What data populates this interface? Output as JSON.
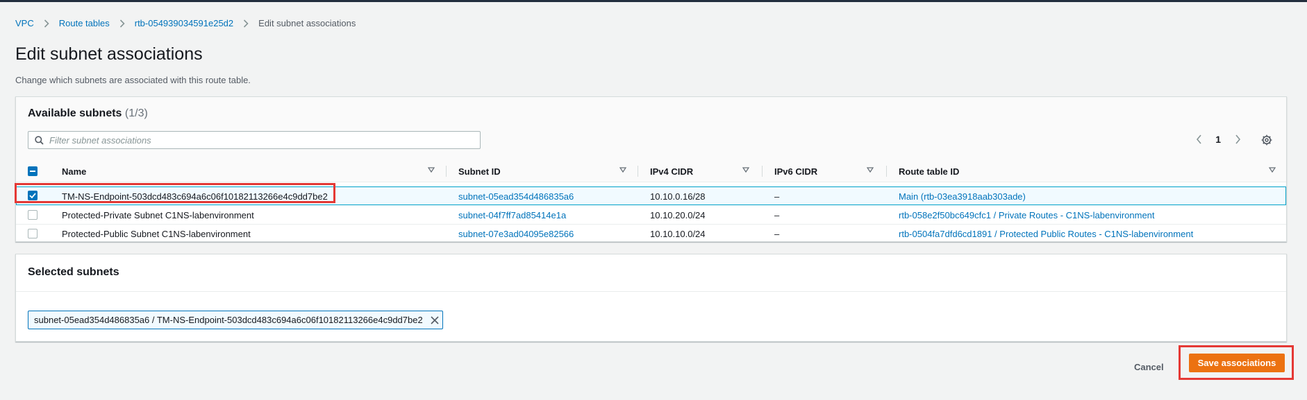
{
  "breadcrumb": {
    "items": [
      "VPC",
      "Route tables",
      "rtb-054939034591e25d2"
    ],
    "current": "Edit subnet associations"
  },
  "page": {
    "title": "Edit subnet associations",
    "description": "Change which subnets are associated with this route table."
  },
  "available": {
    "title": "Available subnets",
    "count": "(1/3)",
    "filter_placeholder": "Filter subnet associations",
    "filter_value": "",
    "page": "1",
    "columns": [
      "Name",
      "Subnet ID",
      "IPv4 CIDR",
      "IPv6 CIDR",
      "Route table ID"
    ],
    "rows": [
      {
        "checked": true,
        "name": "TM-NS-Endpoint-503dcd483c694a6c06f10182113266e4c9dd7be2",
        "subnet_id": "subnet-05ead354d486835a6",
        "ipv4": "10.10.0.16/28",
        "ipv6": "–",
        "route_table": "Main (rtb-03ea3918aab303ade)"
      },
      {
        "checked": false,
        "name": "Protected-Private Subnet C1NS-labenvironment",
        "subnet_id": "subnet-04f7ff7ad85414e1a",
        "ipv4": "10.10.20.0/24",
        "ipv6": "–",
        "route_table": "rtb-058e2f50bc649cfc1 / Private Routes - C1NS-labenvironment"
      },
      {
        "checked": false,
        "name": "Protected-Public Subnet C1NS-labenvironment",
        "subnet_id": "subnet-07e3ad04095e82566",
        "ipv4": "10.10.10.0/24",
        "ipv6": "–",
        "route_table": "rtb-0504fa7dfd6cd1891 / Protected Public Routes - C1NS-labenvironment"
      }
    ]
  },
  "selected": {
    "title": "Selected subnets",
    "tokens": [
      "subnet-05ead354d486835a6 / TM-NS-Endpoint-503dcd483c694a6c06f10182113266e4c9dd7be2"
    ]
  },
  "actions": {
    "cancel_label": "Cancel",
    "save_label": "Save associations"
  },
  "colors": {
    "link": "#0073bb",
    "primary_button": "#ec7211",
    "highlight": "#e53935",
    "selected_row_bg": "#f1faff"
  },
  "icons": [
    "chevron-right-icon",
    "search-icon",
    "chevron-left-icon",
    "gear-icon",
    "sort-caret-icon",
    "checkmark-icon",
    "close-icon"
  ]
}
